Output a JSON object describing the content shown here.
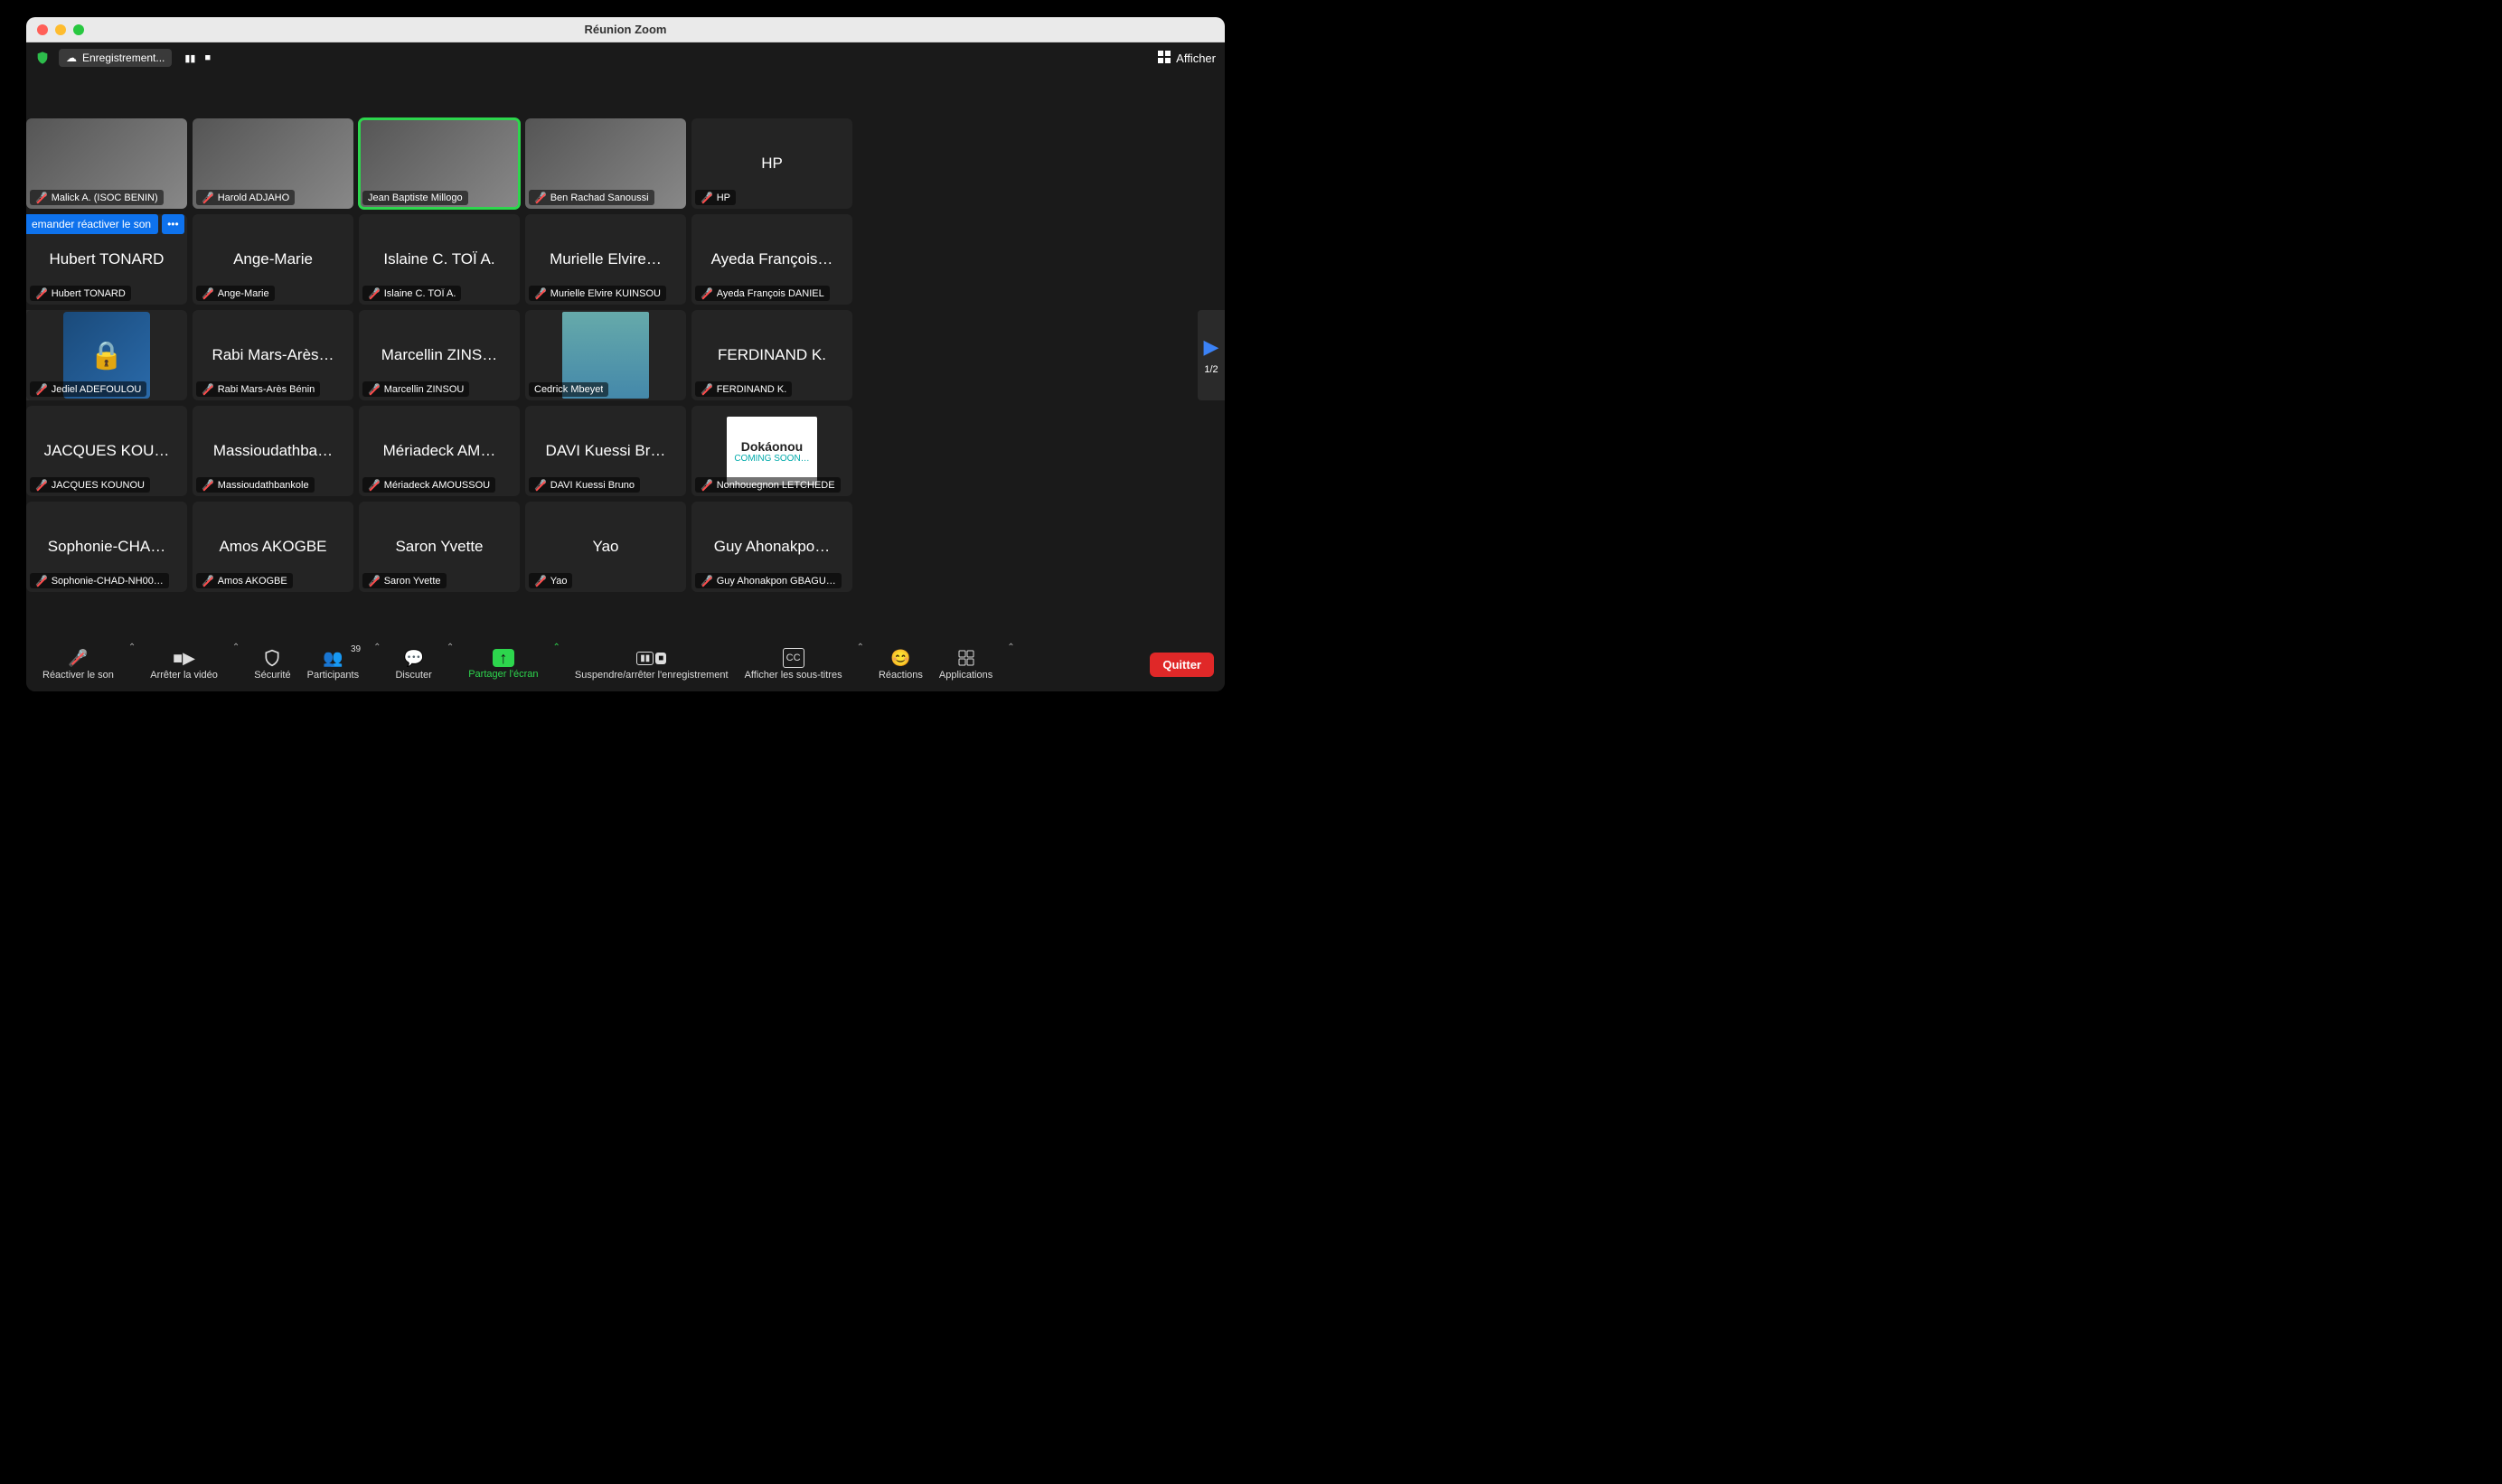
{
  "window": {
    "title": "Réunion Zoom"
  },
  "topbar": {
    "recording_label": "Enregistrement...",
    "view_label": "Afficher"
  },
  "pagination": {
    "left": "1/2",
    "right": "1/2"
  },
  "hover": {
    "request_unmute": "emander réactiver le son",
    "more": "•••"
  },
  "participants": [
    [
      {
        "name": "Malick A. (ISOC BENIN)",
        "video": true,
        "muted": true
      },
      {
        "name": "Harold ADJAHO",
        "video": true,
        "muted": true
      },
      {
        "name": "Jean Baptiste Millogo",
        "video": true,
        "muted": false,
        "speaking": true
      },
      {
        "name": "Ben Rachad Sanoussi",
        "video": true,
        "muted": true
      },
      {
        "name": "HP",
        "big": "HP",
        "muted": true
      }
    ],
    [
      {
        "name": "Hubert TONARD",
        "big": "Hubert TONARD",
        "muted": true,
        "hover": true
      },
      {
        "name": "Ange-Marie",
        "big": "Ange-Marie",
        "muted": true
      },
      {
        "name": "Islaine C. TOÏ A.",
        "big": "Islaine C. TOÏ A.",
        "muted": true
      },
      {
        "name": "Murielle Elvire KUINSOU",
        "big": "Murielle Elvire…",
        "muted": true
      },
      {
        "name": "Ayeda François DANIEL",
        "big": "Ayeda François…",
        "muted": true
      }
    ],
    [
      {
        "name": "Jediel ADEFOULOU",
        "avatar": "lock",
        "muted": true
      },
      {
        "name": "Rabi Mars-Arès Bénin",
        "big": "Rabi Mars-Arès…",
        "muted": true
      },
      {
        "name": "Marcellin ZINSOU",
        "big": "Marcellin ZINS…",
        "muted": true
      },
      {
        "name": "Cedrick Mbeyet",
        "avatar": "photo"
      },
      {
        "name": "FERDINAND K.",
        "big": "FERDINAND K.",
        "muted": true
      }
    ],
    [
      {
        "name": "JACQUES KOUNOU",
        "big": "JACQUES KOU…",
        "muted": true
      },
      {
        "name": "Massioudathbankole",
        "big": "Massioudathba…",
        "muted": true
      },
      {
        "name": "Mériadeck AMOUSSOU",
        "big": "Mériadeck AM…",
        "muted": true
      },
      {
        "name": "DAVI Kuessi Bruno",
        "big": "DAVI Kuessi Br…",
        "muted": true
      },
      {
        "name": "Nonhouegnon LETCHEDE",
        "avatar": "logo",
        "muted": true,
        "logo1": "Dokáonou",
        "logo2": "COMING SOON…"
      }
    ],
    [
      {
        "name": "Sophonie-CHAD-NH00…",
        "big": "Sophonie-CHA…",
        "muted": true
      },
      {
        "name": "Amos AKOGBE",
        "big": "Amos AKOGBE",
        "muted": true
      },
      {
        "name": "Saron Yvette",
        "big": "Saron Yvette",
        "muted": true
      },
      {
        "name": "Yao",
        "big": "Yao",
        "muted": true
      },
      {
        "name": "Guy Ahonakpon GBAGU…",
        "big": "Guy Ahonakpo…",
        "muted": true
      }
    ]
  ],
  "toolbar": {
    "audio": "Réactiver le son",
    "video": "Arrêter la vidéo",
    "security": "Sécurité",
    "participants": "Participants",
    "participants_count": "39",
    "chat": "Discuter",
    "share": "Partager l'écran",
    "record": "Suspendre/arrêter l'enregistrement",
    "cc": "Afficher les sous-titres",
    "reactions": "Réactions",
    "apps": "Applications",
    "leave": "Quitter"
  }
}
